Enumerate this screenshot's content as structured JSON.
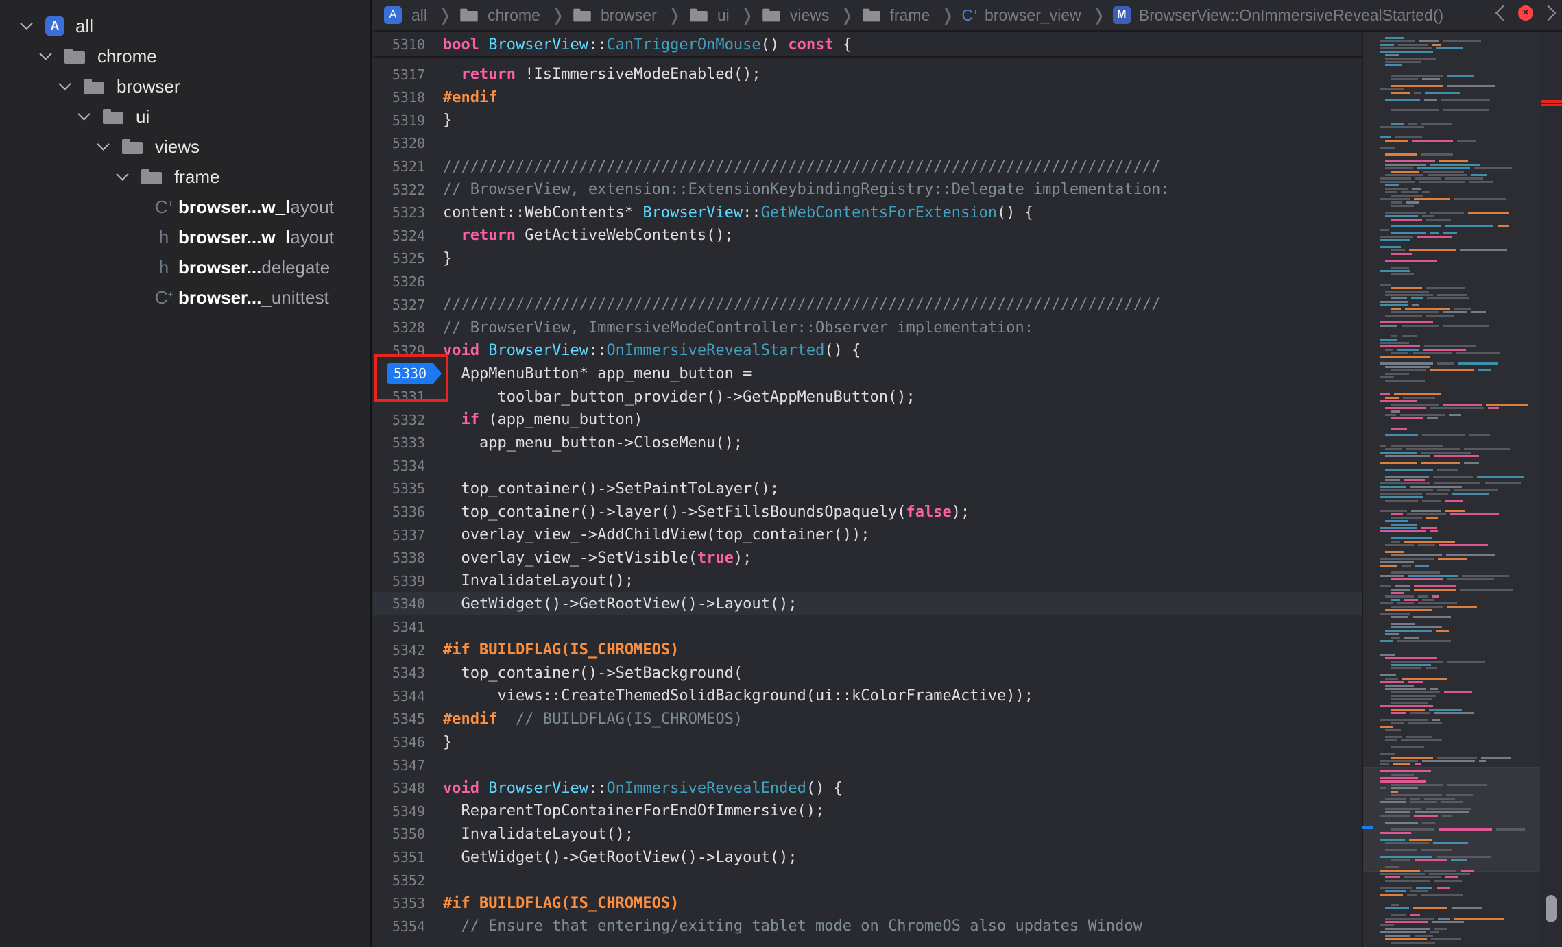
{
  "sidebar": {
    "tree": [
      {
        "label": "all",
        "kind": "project",
        "expanded": true
      },
      {
        "label": "chrome",
        "kind": "folder",
        "expanded": true
      },
      {
        "label": "browser",
        "kind": "folder",
        "expanded": true
      },
      {
        "label": "ui",
        "kind": "folder",
        "expanded": true
      },
      {
        "label": "views",
        "kind": "folder",
        "expanded": true
      },
      {
        "label": "frame",
        "kind": "folder",
        "expanded": true
      }
    ],
    "files": [
      {
        "glyph": "C",
        "sup": "+",
        "bold": "browser...w_l",
        "dim": "ayout"
      },
      {
        "glyph": "h",
        "sup": "",
        "bold": "browser...w_l",
        "dim": "ayout"
      },
      {
        "glyph": "h",
        "sup": "",
        "bold": "browser...",
        "dim": "delegate"
      },
      {
        "glyph": "C",
        "sup": "+",
        "bold": "browser...",
        "dim": "_unittest"
      }
    ]
  },
  "jumpbar": {
    "crumbs": [
      "all",
      "chrome",
      "browser",
      "ui",
      "views",
      "frame"
    ],
    "file": "browser_view",
    "method_badge": "M",
    "method": "BrowserView::OnImmersiveRevealStarted()",
    "error_icon": "×"
  },
  "editor": {
    "breakpoint_line": "5330",
    "current_line": "5340",
    "lines": [
      {
        "n": "5310",
        "t": "<span class=\"kw\">bool</span> <span class=\"ty\">BrowserView</span>::<span class=\"fn\">CanTriggerOnMouse</span>() <span class=\"kw\">const</span> {"
      },
      {
        "n": "5317",
        "t": "  <span class=\"kw\">return</span> !IsImmersiveModeEnabled();"
      },
      {
        "n": "5318",
        "t": "<span class=\"pp\">#endif</span>"
      },
      {
        "n": "5319",
        "t": "}"
      },
      {
        "n": "5320",
        "t": ""
      },
      {
        "n": "5321",
        "t": "<span class=\"cm\">///////////////////////////////////////////////////////////////////////////////</span>"
      },
      {
        "n": "5322",
        "t": "<span class=\"cm\">// BrowserView, extension::ExtensionKeybindingRegistry::Delegate implementation:</span>"
      },
      {
        "n": "5323",
        "t": "content::WebContents* <span class=\"ty\">BrowserView</span>::<span class=\"fn\">GetWebContentsForExtension</span>() {"
      },
      {
        "n": "5324",
        "t": "  <span class=\"kw\">return</span> GetActiveWebContents();"
      },
      {
        "n": "5325",
        "t": "}"
      },
      {
        "n": "5326",
        "t": ""
      },
      {
        "n": "5327",
        "t": "<span class=\"cm\">///////////////////////////////////////////////////////////////////////////////</span>"
      },
      {
        "n": "5328",
        "t": "<span class=\"cm\">// BrowserView, ImmersiveModeController::Observer implementation:</span>"
      },
      {
        "n": "5329",
        "t": "<span class=\"kw\">void</span> <span class=\"ty\">BrowserView</span>::<span class=\"fn\">OnImmersiveRevealStarted</span>() {"
      },
      {
        "n": "5330",
        "t": "  AppMenuButton* app_menu_button ="
      },
      {
        "n": "5331",
        "t": "      toolbar_button_provider()->GetAppMenuButton();"
      },
      {
        "n": "5332",
        "t": "  <span class=\"kw\">if</span> (app_menu_button)"
      },
      {
        "n": "5333",
        "t": "    app_menu_button->CloseMenu();"
      },
      {
        "n": "5334",
        "t": ""
      },
      {
        "n": "5335",
        "t": "  top_container()->SetPaintToLayer();"
      },
      {
        "n": "5336",
        "t": "  top_container()->layer()->SetFillsBoundsOpaquely(<span class=\"kw\">false</span>);"
      },
      {
        "n": "5337",
        "t": "  overlay_view_->AddChildView(top_container());"
      },
      {
        "n": "5338",
        "t": "  overlay_view_->SetVisible(<span class=\"kw\">true</span>);"
      },
      {
        "n": "5339",
        "t": "  InvalidateLayout();"
      },
      {
        "n": "5340",
        "t": "  GetWidget()->GetRootView()->Layout();"
      },
      {
        "n": "5341",
        "t": ""
      },
      {
        "n": "5342",
        "t": "<span class=\"pp\">#if BUILDFLAG(IS_CHROMEOS)</span>"
      },
      {
        "n": "5343",
        "t": "  top_container()->SetBackground("
      },
      {
        "n": "5344",
        "t": "      views::CreateThemedSolidBackground(ui::kColorFrameActive));"
      },
      {
        "n": "5345",
        "t": "<span class=\"pp\">#endif</span>  <span class=\"cm\">// BUILDFLAG(IS_CHROMEOS)</span>"
      },
      {
        "n": "5346",
        "t": "}"
      },
      {
        "n": "5347",
        "t": ""
      },
      {
        "n": "5348",
        "t": "<span class=\"kw\">void</span> <span class=\"ty\">BrowserView</span>::<span class=\"fn\">OnImmersiveRevealEnded</span>() {"
      },
      {
        "n": "5349",
        "t": "  ReparentTopContainerForEndOfImmersive();"
      },
      {
        "n": "5350",
        "t": "  InvalidateLayout();"
      },
      {
        "n": "5351",
        "t": "  GetWidget()->GetRootView()->Layout();"
      },
      {
        "n": "5352",
        "t": ""
      },
      {
        "n": "5353",
        "t": "<span class=\"pp\">#if BUILDFLAG(IS_CHROMEOS)</span>"
      },
      {
        "n": "5354",
        "t": "  <span class=\"cm\">// Ensure that entering/exiting tablet mode on ChromeOS also updates Window</span>"
      }
    ]
  },
  "colors": {
    "keyword": "#fc5fa3",
    "preprocessor": "#fd8f3f",
    "type": "#5dd8ff",
    "function": "#41a1c0",
    "comment": "#7f8c98",
    "breakpoint": "#1c79f3",
    "annotation_box": "#e8251c"
  }
}
